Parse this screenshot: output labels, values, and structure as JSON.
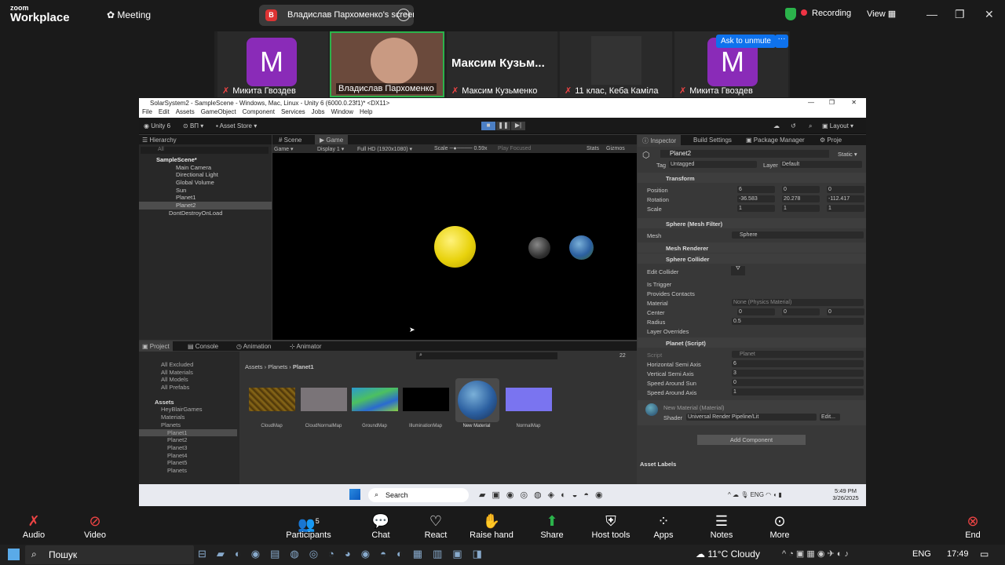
{
  "zoom": {
    "logo_line1": "zoom",
    "logo_line2": "Workplace",
    "meeting_label": "Meeting",
    "share_badge": "В",
    "share_text": "Владислав Пархоменко's screen",
    "recording": "Recording",
    "view": "View",
    "colors": {
      "accent": "#0e72ed",
      "green": "#2bb34b",
      "red": "#e34"
    }
  },
  "participants": [
    {
      "name": "Микита Гвоздев",
      "avatar": "M"
    },
    {
      "name": "Владислав Пархоменко"
    },
    {
      "name": "Максим Кузьменко",
      "big": "Максим  Кузьм..."
    },
    {
      "name": "11 клас, Кеба Каміла"
    },
    {
      "name": "Микита Гвоздев",
      "avatar": "M",
      "unmute": "Ask to unmute",
      "more": "···"
    }
  ],
  "unity": {
    "title": "SolarSystem2 - SampleScene - Windows, Mac, Linux - Unity 6 (6000.0.23f1)* <DX11>",
    "menu": [
      "File",
      "Edit",
      "Assets",
      "GameObject",
      "Component",
      "Services",
      "Jobs",
      "Window",
      "Help"
    ],
    "toolbar": {
      "version": "Unity 6",
      "account": "ВП",
      "store": "Asset Store",
      "layout": "Layout"
    },
    "hierarchy": {
      "tab": "Hierarchy",
      "search": "All",
      "scene": "SampleScene*",
      "items": [
        "Main Camera",
        "Directional Light",
        "Global Volume",
        "Sun",
        "Planet1",
        "Planet2"
      ],
      "ddol": "DontDestroyOnLoad"
    },
    "game": {
      "tabs": [
        "Scene",
        "Game"
      ],
      "mode": "Game",
      "display": "Display 1",
      "res": "Full HD (1920x1080)",
      "scale_label": "Scale",
      "scale": "0.59x",
      "play_focused": "Play Focused",
      "stats": "Stats",
      "gizmos": "Gizmos"
    },
    "inspector": {
      "tabs": [
        "Inspector",
        "Build Settings",
        "Package Manager",
        "Proje"
      ],
      "name": "Planet2",
      "static": "Static",
      "tag_label": "Tag",
      "tag": "Untagged",
      "layer_label": "Layer",
      "layer": "Default",
      "transform": "Transform",
      "position": {
        "label": "Position",
        "x": "6",
        "y": "0",
        "z": "0"
      },
      "rotation": {
        "label": "Rotation",
        "x": "-36.583",
        "y": "20.278",
        "z": "-112.417"
      },
      "scale": {
        "label": "Scale",
        "x": "1",
        "y": "1",
        "z": "1"
      },
      "meshfilter": "Sphere (Mesh Filter)",
      "mesh_label": "Mesh",
      "mesh": "Sphere",
      "meshrenderer": "Mesh Renderer",
      "collider": "Sphere Collider",
      "collider_rows": [
        "Edit Collider",
        "Is Trigger",
        "Provides Contacts",
        "Material",
        "Center",
        "Radius",
        "Layer Overrides"
      ],
      "material_val": "None (Physics Material)",
      "center": {
        "x": "0",
        "y": "0",
        "z": "0"
      },
      "radius": "0.5",
      "script_title": "Planet (Script)",
      "script_label": "Script",
      "script": "Planet",
      "script_rows": [
        {
          "k": "Horizontal Semi Axis",
          "v": "6"
        },
        {
          "k": "Vertical Semi Axis",
          "v": "3"
        },
        {
          "k": "Speed Around Sun",
          "v": "0"
        },
        {
          "k": "Speed Around Axis",
          "v": "1"
        }
      ],
      "matname": "New Material (Material)",
      "shader_label": "Shader",
      "shader": "Universal Render Pipeline/Lit",
      "edit": "Edit...",
      "add_component": "Add Component",
      "asset_labels": "Asset Labels"
    },
    "project": {
      "tabs": [
        "Project",
        "Console",
        "Animation",
        "Animator"
      ],
      "favorites": [
        "All Excluded",
        "All Materials",
        "All Models",
        "All Prefabs"
      ],
      "tree": [
        "Assets",
        "HeyBlairGames",
        "Materials",
        "Planets",
        "Planet1",
        "Planet2",
        "Planet3",
        "Planet4",
        "Planet5",
        "Planets"
      ],
      "breadcrumb": [
        "Assets",
        "Planets",
        "Planet1"
      ],
      "count": "22",
      "assets": [
        "CloudMap",
        "CloudNormalMap",
        "GroundMap",
        "IlluminationMap",
        "New Material",
        "NormalMap"
      ]
    }
  },
  "win_inner": {
    "search": "Search",
    "lang": "ENG",
    "time": "5:49 PM",
    "date": "3/26/2025"
  },
  "zoom_bar": {
    "audio": "Audio",
    "video": "Video",
    "participants": "Participants",
    "participants_count": "5",
    "chat": "Chat",
    "react": "React",
    "raise": "Raise hand",
    "share": "Share",
    "host": "Host tools",
    "apps": "Apps",
    "notes": "Notes",
    "more": "More",
    "end": "End"
  },
  "taskbar": {
    "search": "Пошук",
    "weather": "11°C  Cloudy",
    "lang": "ENG",
    "time": "17:49"
  }
}
